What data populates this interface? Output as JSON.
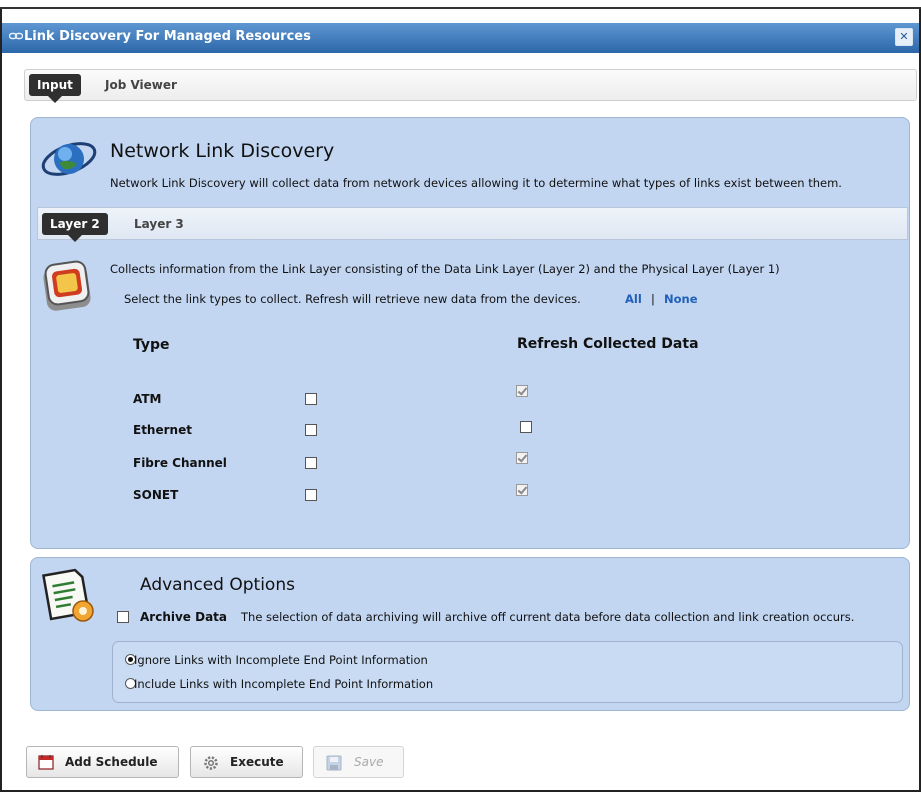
{
  "window": {
    "title": "Link Discovery For Managed Resources",
    "close_glyph": "✕"
  },
  "top_tabs": {
    "active": "Input",
    "other": "Job Viewer"
  },
  "discovery": {
    "heading": "Network Link Discovery",
    "description": "Network Link Discovery will collect data from network devices allowing it to determine what types of links exist between them."
  },
  "layer_tabs": {
    "active": "Layer 2",
    "other": "Layer 3"
  },
  "layer2": {
    "info": "Collects information from the Link Layer consisting of the Data Link Layer (Layer 2) and the Physical Layer (Layer 1)",
    "select_text": "Select the link types to collect. Refresh will retrieve new data from the devices.",
    "all_link": "All",
    "separator": "|",
    "none_link": "None",
    "col_type": "Type",
    "col_refresh": "Refresh Collected Data",
    "rows": [
      {
        "type": "ATM",
        "selected": false,
        "refresh": true,
        "refresh_enabled": false
      },
      {
        "type": "Ethernet",
        "selected": false,
        "refresh": false,
        "refresh_enabled": true
      },
      {
        "type": "Fibre Channel",
        "selected": false,
        "refresh": true,
        "refresh_enabled": false
      },
      {
        "type": "SONET",
        "selected": false,
        "refresh": true,
        "refresh_enabled": false
      }
    ]
  },
  "advanced": {
    "heading": "Advanced Options",
    "archive_label": "Archive Data",
    "archive_checked": false,
    "archive_desc": "The selection of data archiving will archive off current data before data collection and link creation occurs.",
    "options": [
      {
        "label": "Ignore Links with Incomplete End Point Information",
        "selected": true
      },
      {
        "label": "Include Links with Incomplete End Point Information",
        "selected": false
      }
    ]
  },
  "buttons": {
    "add_schedule": "Add Schedule",
    "execute": "Execute",
    "save": "Save"
  },
  "colors": {
    "titlebar": "#2c67a9",
    "panel": "#c2d6f2",
    "link": "#2060b8",
    "tab_active": "#2f2f2f"
  }
}
